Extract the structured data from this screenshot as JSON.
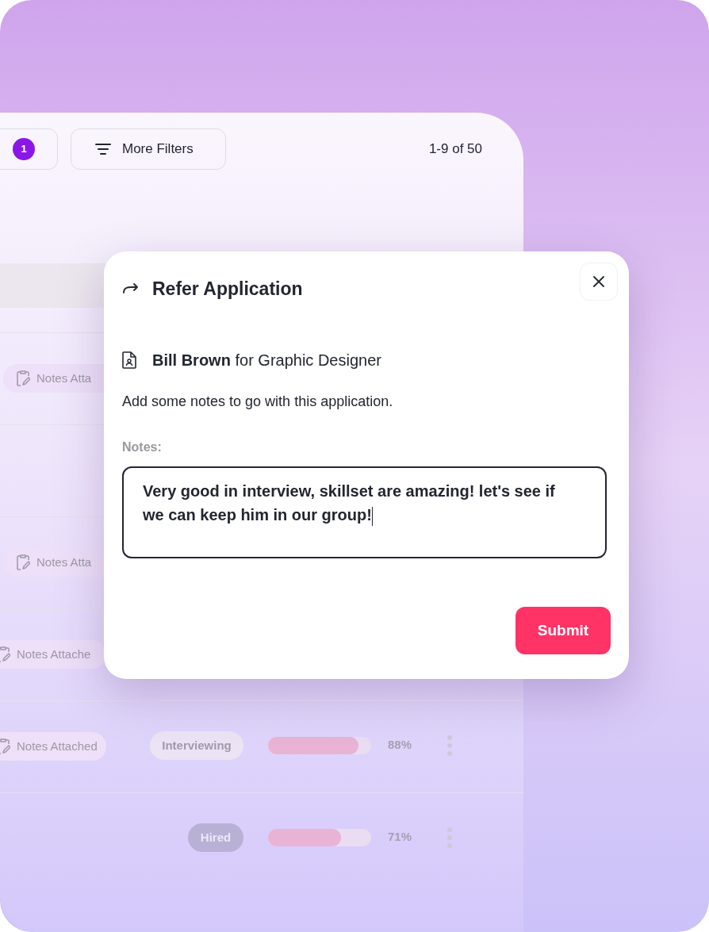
{
  "toolbar": {
    "filter_badge": "1",
    "more_filters": "More Filters",
    "range": "1-9 of 50"
  },
  "rows": [
    {
      "notes": "Notes Atta"
    },
    {},
    {
      "notes": "Notes Atta"
    },
    {
      "notes": "Notes Attache"
    },
    {
      "notes": "Notes Attached",
      "status": "Interviewing",
      "kind": "interviewing",
      "level": 0.88,
      "score": "88%"
    },
    {
      "status": "Hired",
      "kind": "hired",
      "level": 0.71,
      "score": "71%"
    }
  ],
  "dialog": {
    "title": "Refer Application",
    "candidate": "**Bill Brown** for Graphic Designer",
    "description": "Add some notes to go with this application.",
    "notes_label": "Notes:",
    "notes_value": "Very good in interview, skillset are amazing! let's see if we can keep him in our group!",
    "submit": "Submit"
  }
}
